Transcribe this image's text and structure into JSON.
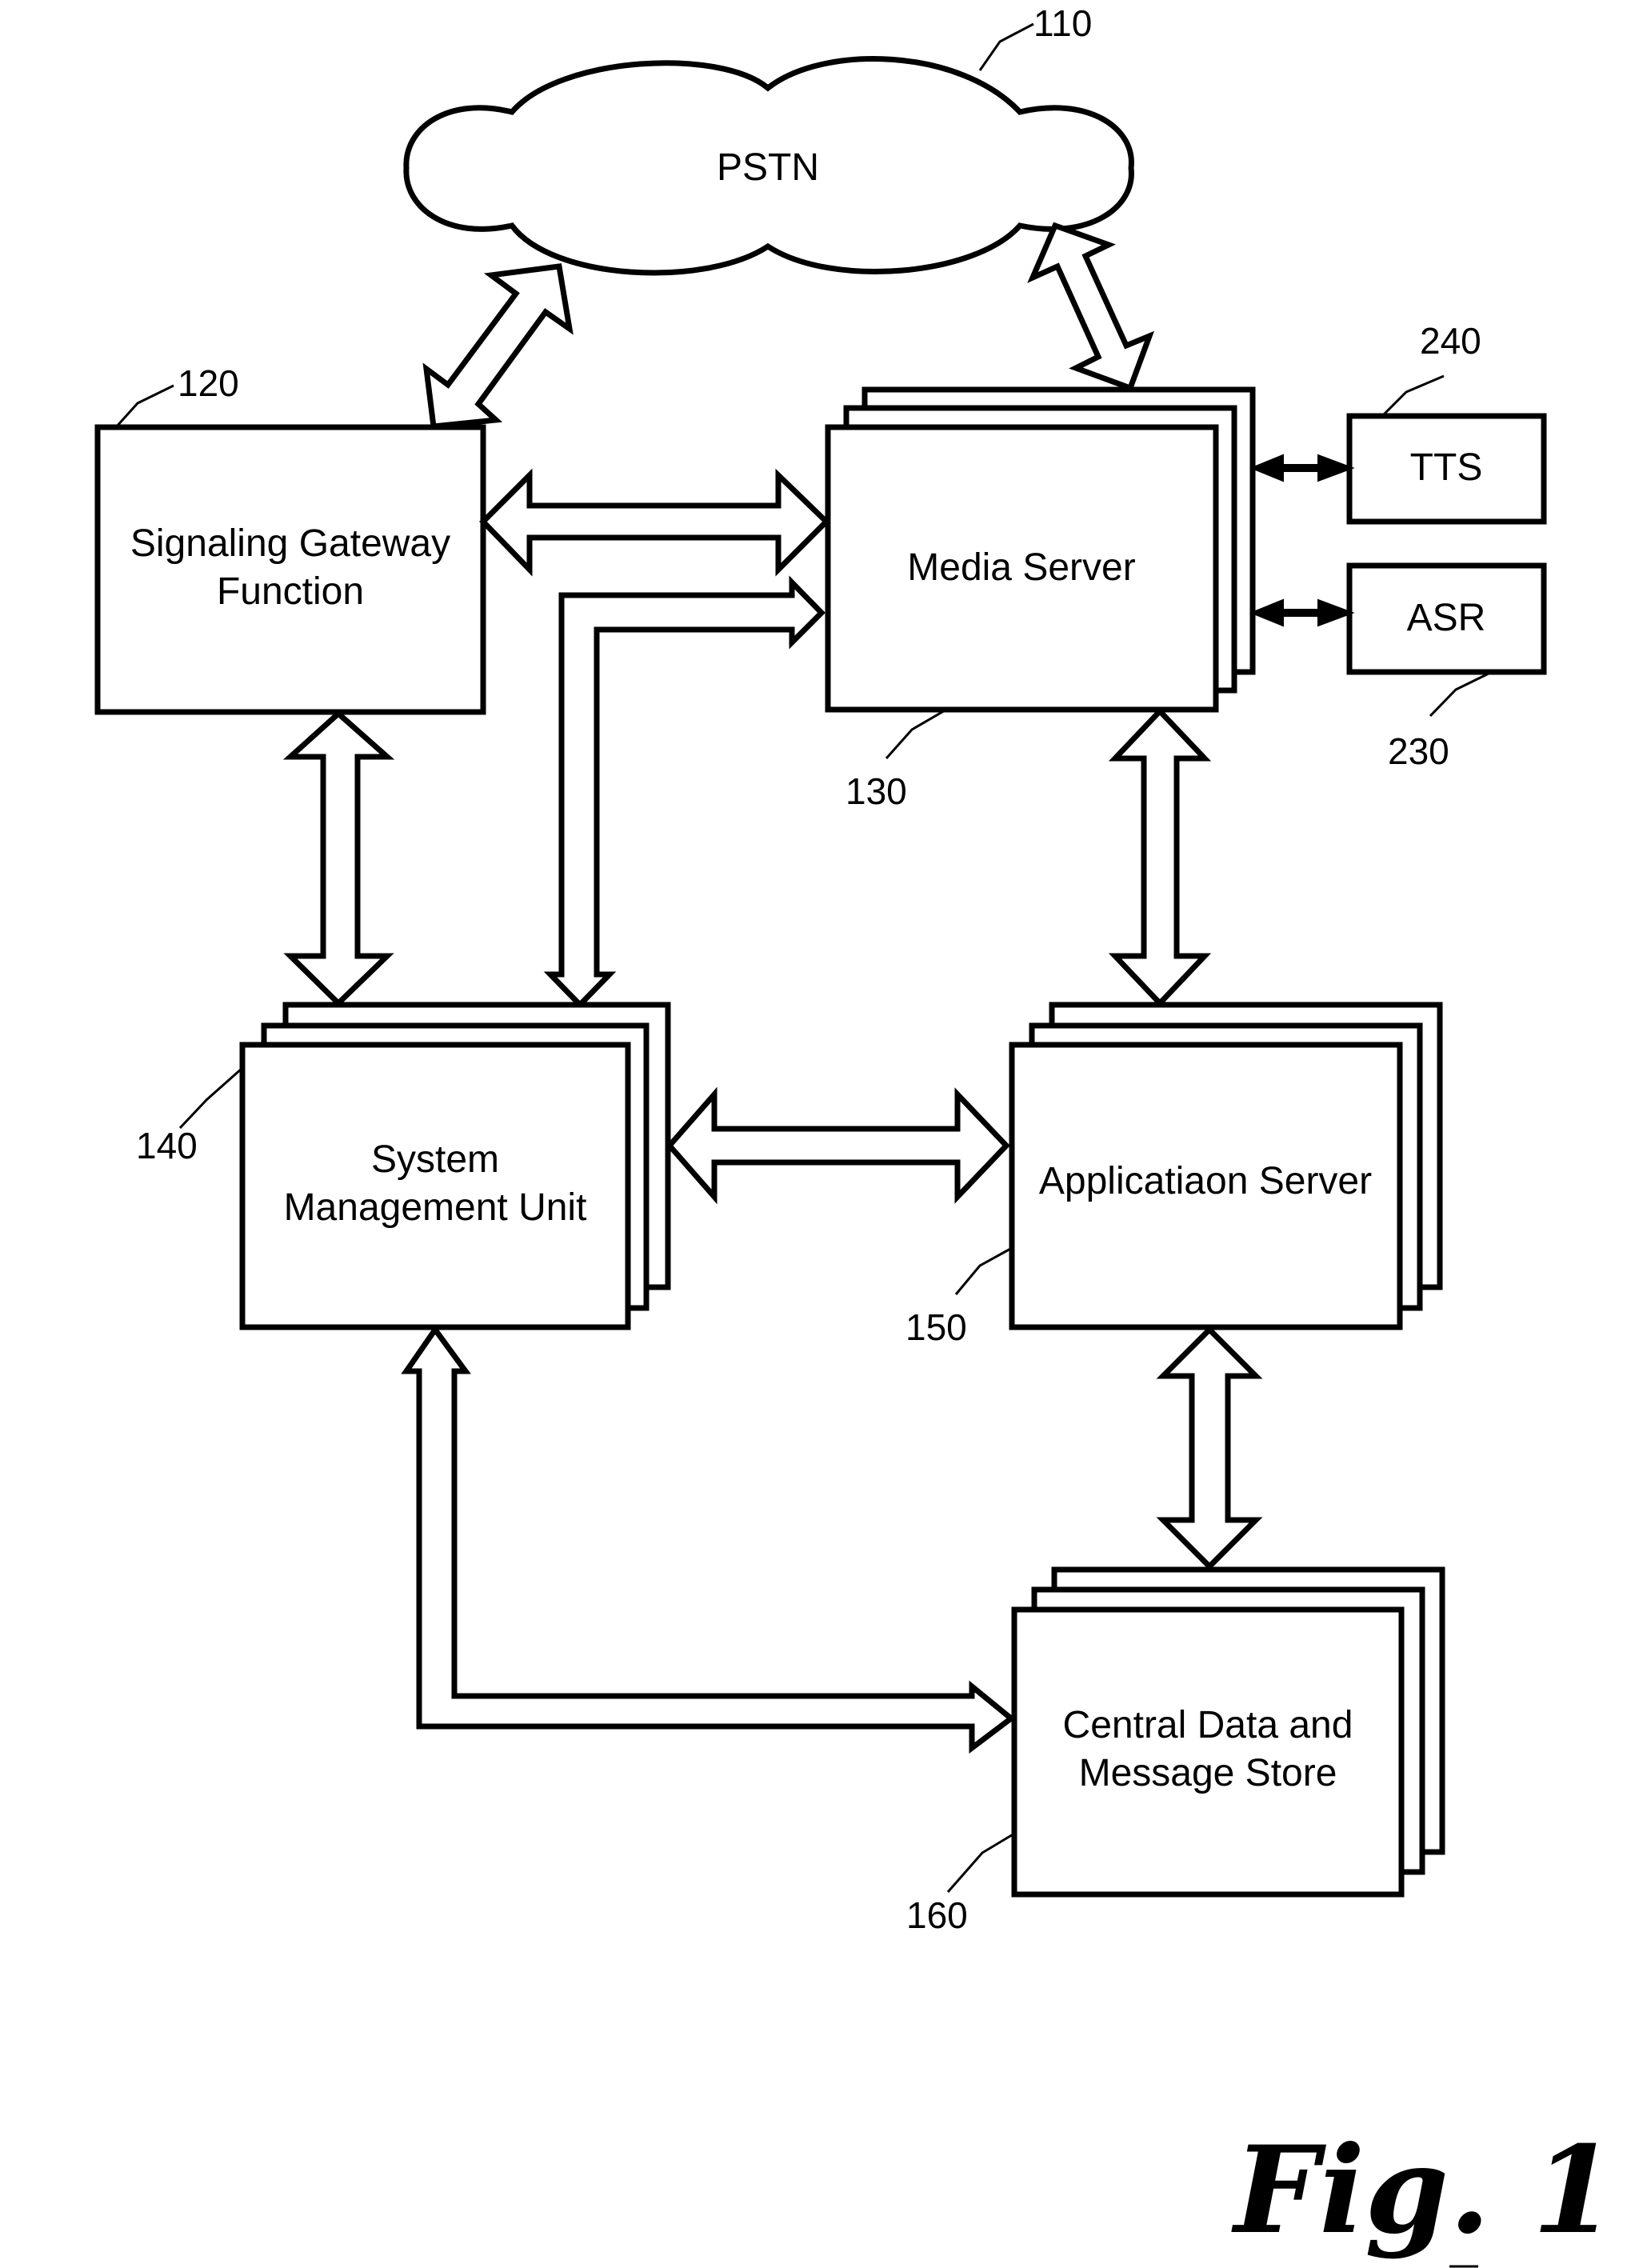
{
  "figure": {
    "label": "Fig. 1",
    "colors": {
      "stroke": "#000000",
      "background": "#ffffff"
    }
  },
  "nodes": {
    "pstn": {
      "ref": "110",
      "lines": [
        "PSTN"
      ]
    },
    "sgf": {
      "ref": "120",
      "lines": [
        "Signaling Gateway",
        "Function"
      ]
    },
    "media_server": {
      "ref": "130",
      "lines": [
        "Media Server"
      ]
    },
    "smu": {
      "ref": "140",
      "lines": [
        "System",
        "Management Unit"
      ]
    },
    "app_server": {
      "ref": "150",
      "lines": [
        "Applicatiaon Server"
      ]
    },
    "cdms": {
      "ref": "160",
      "lines": [
        "Central Data and",
        "Message Store"
      ]
    },
    "asr": {
      "ref": "230",
      "lines": [
        "ASR"
      ]
    },
    "tts": {
      "ref": "240",
      "lines": [
        "TTS"
      ]
    }
  },
  "connections": [
    {
      "from": "pstn",
      "to": "sgf",
      "type": "bidirectional"
    },
    {
      "from": "pstn",
      "to": "media_server",
      "type": "bidirectional"
    },
    {
      "from": "sgf",
      "to": "media_server",
      "type": "bidirectional"
    },
    {
      "from": "smu",
      "to": "media_server",
      "type": "bidirectional-elbow"
    },
    {
      "from": "sgf",
      "to": "smu",
      "type": "bidirectional"
    },
    {
      "from": "media_server",
      "to": "app_server",
      "type": "bidirectional"
    },
    {
      "from": "smu",
      "to": "app_server",
      "type": "bidirectional"
    },
    {
      "from": "app_server",
      "to": "cdms",
      "type": "bidirectional"
    },
    {
      "from": "smu",
      "to": "cdms",
      "type": "bidirectional-elbow"
    },
    {
      "from": "media_server",
      "to": "tts",
      "type": "bidirectional-line"
    },
    {
      "from": "media_server",
      "to": "asr",
      "type": "bidirectional-line"
    }
  ]
}
